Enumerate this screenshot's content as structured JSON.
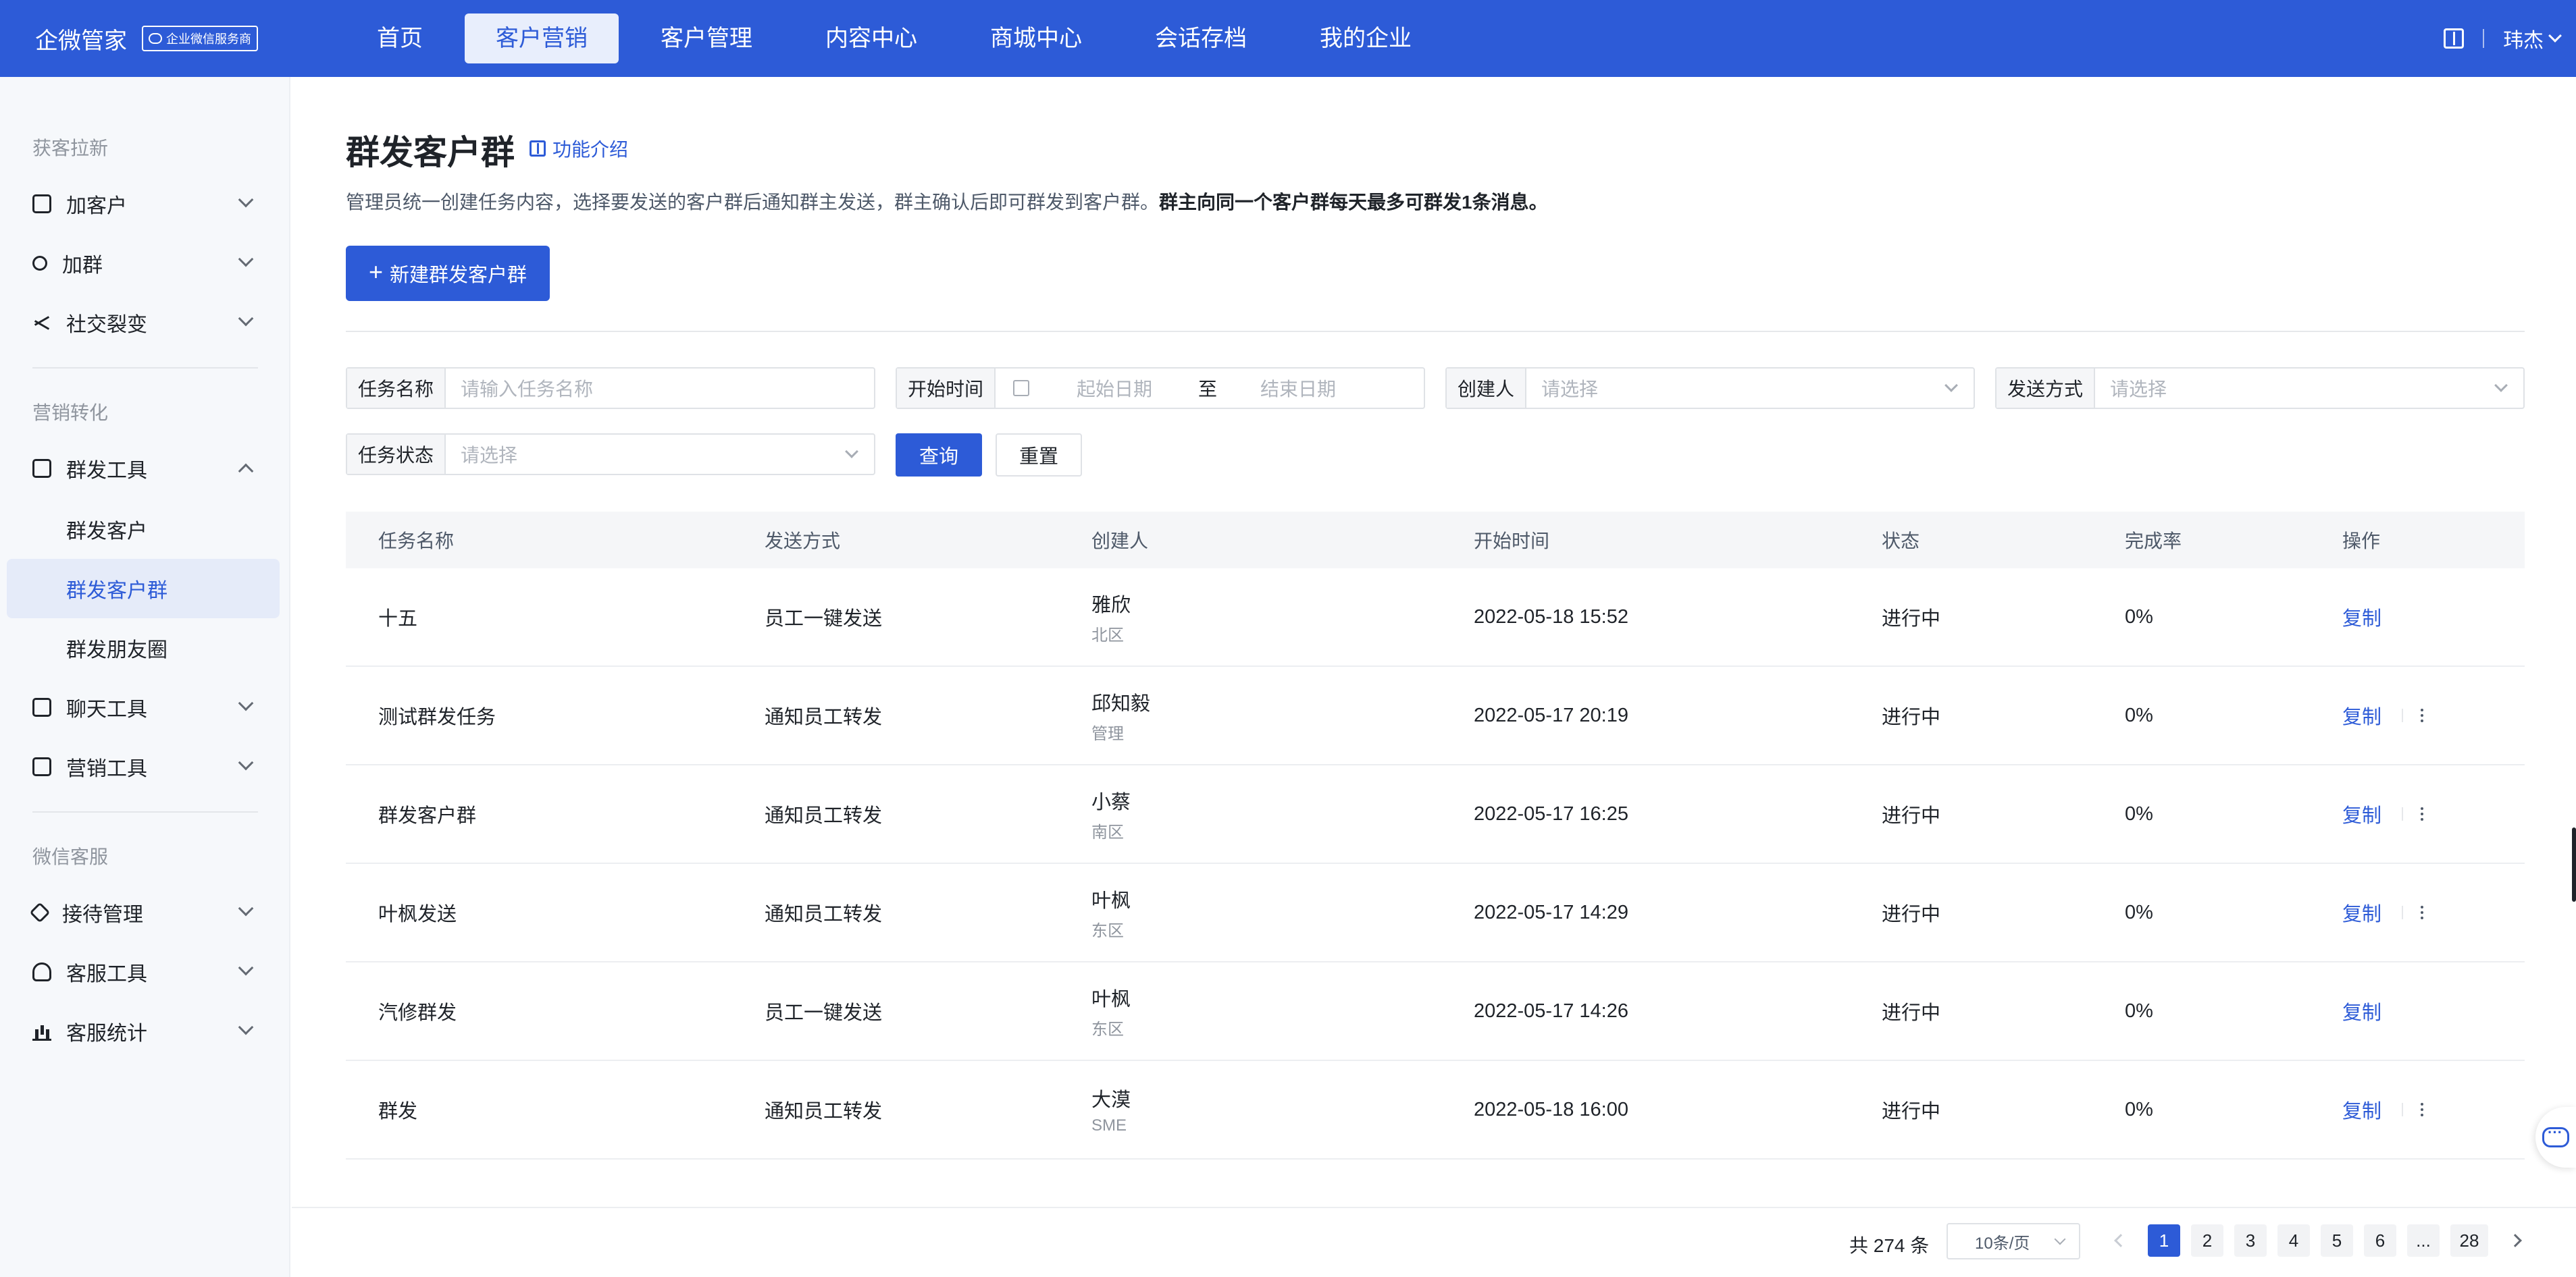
{
  "header": {
    "brand": "企微管家",
    "badge": "企业微信服务商",
    "nav": [
      "首页",
      "客户营销",
      "客户管理",
      "内容中心",
      "商城中心",
      "会话存档",
      "我的企业"
    ],
    "active_nav": "客户营销",
    "user": "玮杰"
  },
  "sidebar": {
    "sections": [
      {
        "title": "获客拉新",
        "items": [
          {
            "label": "加客户",
            "icon": "grid-icon"
          },
          {
            "label": "加群",
            "icon": "user-icon"
          },
          {
            "label": "社交裂变",
            "icon": "share-icon"
          }
        ]
      },
      {
        "title": "营销转化",
        "items": [
          {
            "label": "群发工具",
            "icon": "send-icon",
            "expanded": true,
            "children": [
              "群发客户",
              "群发客户群",
              "群发朋友圈"
            ]
          },
          {
            "label": "聊天工具",
            "icon": "chat-icon"
          },
          {
            "label": "营销工具",
            "icon": "chart-icon"
          }
        ]
      },
      {
        "title": "微信客服",
        "items": [
          {
            "label": "接待管理",
            "icon": "diamond-icon"
          },
          {
            "label": "客服工具",
            "icon": "headset-icon"
          },
          {
            "label": "客服统计",
            "icon": "bars-icon"
          }
        ]
      }
    ],
    "active_sub": "群发客户群"
  },
  "page": {
    "title": "群发客户群",
    "intro_link": "功能介绍",
    "desc_normal": "管理员统一创建任务内容，选择要发送的客户群后通知群主发送，群主确认后即可群发到客户群。",
    "desc_bold": "群主向同一个客户群每天最多可群发1条消息。",
    "create_button": "新建群发客户群"
  },
  "filters": {
    "task_name": {
      "label": "任务名称",
      "placeholder": "请输入任务名称"
    },
    "start_time": {
      "label": "开始时间",
      "start_placeholder": "起始日期",
      "to": "至",
      "end_placeholder": "结束日期"
    },
    "creator": {
      "label": "创建人",
      "placeholder": "请选择"
    },
    "send_method": {
      "label": "发送方式",
      "placeholder": "请选择"
    },
    "task_status": {
      "label": "任务状态",
      "placeholder": "请选择"
    },
    "query": "查询",
    "reset": "重置"
  },
  "table": {
    "columns": [
      "任务名称",
      "发送方式",
      "创建人",
      "开始时间",
      "状态",
      "完成率",
      "操作"
    ],
    "rows": [
      {
        "name": "十五",
        "method": "员工一键发送",
        "creator": "雅欣",
        "dept": "北区",
        "start": "2022-05-18 15:52",
        "status": "进行中",
        "rate": "0%",
        "action": "复制",
        "more": false
      },
      {
        "name": "测试群发任务",
        "method": "通知员工转发",
        "creator": "邱知毅",
        "dept": "管理",
        "start": "2022-05-17 20:19",
        "status": "进行中",
        "rate": "0%",
        "action": "复制",
        "more": true
      },
      {
        "name": "群发客户群",
        "method": "通知员工转发",
        "creator": "小蔡",
        "dept": "南区",
        "start": "2022-05-17 16:25",
        "status": "进行中",
        "rate": "0%",
        "action": "复制",
        "more": true
      },
      {
        "name": "叶枫发送",
        "method": "通知员工转发",
        "creator": "叶枫",
        "dept": "东区",
        "start": "2022-05-17 14:29",
        "status": "进行中",
        "rate": "0%",
        "action": "复制",
        "more": true
      },
      {
        "name": "汽修群发",
        "method": "员工一键发送",
        "creator": "叶枫",
        "dept": "东区",
        "start": "2022-05-17 14:26",
        "status": "进行中",
        "rate": "0%",
        "action": "复制",
        "more": false
      },
      {
        "name": "群发",
        "method": "通知员工转发",
        "creator": "大漠",
        "dept": "SME",
        "start": "2022-05-18 16:00",
        "status": "进行中",
        "rate": "0%",
        "action": "复制",
        "more": true
      }
    ]
  },
  "pagination": {
    "total": "共 274 条",
    "page_size": "10条/页",
    "pages": [
      "1",
      "2",
      "3",
      "4",
      "5",
      "6",
      "...",
      "28"
    ],
    "current": "1"
  },
  "colors": {
    "primary": "#2d5bd7",
    "active_bg": "#e5ebf9"
  }
}
